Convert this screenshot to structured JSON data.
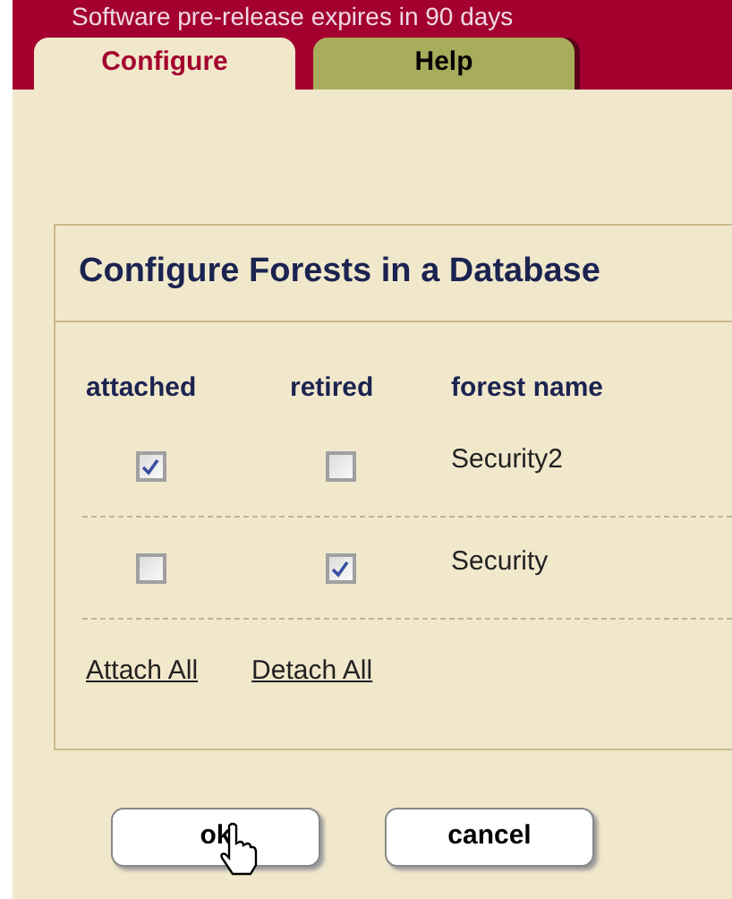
{
  "banner": {
    "text": "Software pre-release expires in 90 days"
  },
  "tabs": [
    {
      "label": "Configure",
      "selected": true
    },
    {
      "label": "Help",
      "selected": false
    }
  ],
  "panel": {
    "title": "Configure Forests in a Database",
    "columns": [
      "attached",
      "retired",
      "forest name"
    ],
    "rows": [
      {
        "attached": true,
        "retired": false,
        "name": "Security2"
      },
      {
        "attached": false,
        "retired": true,
        "name": "Security"
      }
    ],
    "links": [
      "Attach All",
      "Detach All"
    ]
  },
  "buttons": [
    "ok",
    "cancel"
  ]
}
